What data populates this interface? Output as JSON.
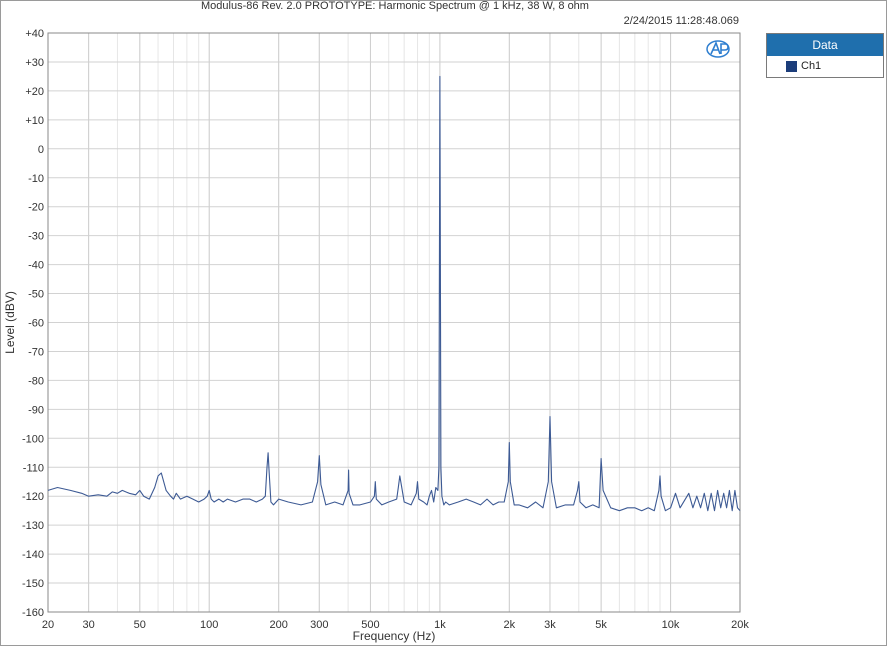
{
  "chart_data": {
    "type": "line",
    "title": "Modulus-86 Rev. 2.0 PROTOTYPE: Harmonic Spectrum @ 1 kHz, 38 W, 8 ohm",
    "timestamp": "2/24/2015 11:28:48.069",
    "xlabel": "Frequency (Hz)",
    "ylabel": "Level (dBV)",
    "x_scale": "log",
    "xlim": [
      20,
      20000
    ],
    "ylim": [
      -160,
      40
    ],
    "x_ticks": [
      {
        "value": 20,
        "label": "20"
      },
      {
        "value": 30,
        "label": "30"
      },
      {
        "value": 50,
        "label": "50"
      },
      {
        "value": 100,
        "label": "100"
      },
      {
        "value": 200,
        "label": "200"
      },
      {
        "value": 300,
        "label": "300"
      },
      {
        "value": 500,
        "label": "500"
      },
      {
        "value": 1000,
        "label": "1k"
      },
      {
        "value": 2000,
        "label": "2k"
      },
      {
        "value": 3000,
        "label": "3k"
      },
      {
        "value": 5000,
        "label": "5k"
      },
      {
        "value": 10000,
        "label": "10k"
      },
      {
        "value": 20000,
        "label": "20k"
      }
    ],
    "y_ticks": [
      {
        "value": 40,
        "label": "+40"
      },
      {
        "value": 30,
        "label": "+30"
      },
      {
        "value": 20,
        "label": "+20"
      },
      {
        "value": 10,
        "label": "+10"
      },
      {
        "value": 0,
        "label": "0"
      },
      {
        "value": -10,
        "label": "-10"
      },
      {
        "value": -20,
        "label": "-20"
      },
      {
        "value": -30,
        "label": "-30"
      },
      {
        "value": -40,
        "label": "-40"
      },
      {
        "value": -50,
        "label": "-50"
      },
      {
        "value": -60,
        "label": "-60"
      },
      {
        "value": -70,
        "label": "-70"
      },
      {
        "value": -80,
        "label": "-80"
      },
      {
        "value": -90,
        "label": "-90"
      },
      {
        "value": -100,
        "label": "-100"
      },
      {
        "value": -110,
        "label": "-110"
      },
      {
        "value": -120,
        "label": "-120"
      },
      {
        "value": -130,
        "label": "-130"
      },
      {
        "value": -140,
        "label": "-140"
      },
      {
        "value": -150,
        "label": "-150"
      },
      {
        "value": -160,
        "label": "-160"
      }
    ],
    "grid": true,
    "legend": {
      "title": "Data",
      "position": "right",
      "entries": [
        {
          "name": "Ch1",
          "color": "#1c3d7a"
        }
      ]
    },
    "series": [
      {
        "name": "Ch1",
        "color": "#3d5a94",
        "x": [
          20,
          22,
          25,
          28,
          30,
          33,
          36,
          38,
          40,
          42,
          45,
          48,
          50,
          52,
          55,
          58,
          60,
          62,
          65,
          68,
          70,
          72,
          75,
          80,
          85,
          90,
          95,
          98,
          100,
          102,
          105,
          110,
          115,
          120,
          130,
          140,
          150,
          160,
          170,
          175,
          178,
          180,
          182,
          185,
          190,
          200,
          220,
          250,
          280,
          295,
          300,
          305,
          320,
          350,
          380,
          400,
          402,
          404,
          420,
          450,
          500,
          520,
          525,
          530,
          560,
          600,
          650,
          660,
          670,
          700,
          750,
          790,
          800,
          810,
          850,
          880,
          900,
          920,
          940,
          960,
          980,
          990,
          1000,
          1010,
          1020,
          1040,
          1060,
          1100,
          1200,
          1300,
          1400,
          1500,
          1600,
          1700,
          1800,
          1900,
          1980,
          2000,
          2020,
          2100,
          2200,
          2400,
          2600,
          2800,
          2950,
          3000,
          3050,
          3200,
          3500,
          3800,
          3950,
          4000,
          4050,
          4300,
          4600,
          4900,
          5000,
          5100,
          5500,
          6000,
          6500,
          7000,
          7500,
          8000,
          8500,
          8900,
          9000,
          9100,
          9500,
          10000,
          10500,
          11000,
          12000,
          12500,
          13000,
          13500,
          14000,
          14500,
          15000,
          15500,
          16000,
          16500,
          17000,
          17500,
          18000,
          18500,
          19000,
          19500,
          20000
        ],
        "y": [
          -118,
          -117,
          -118,
          -119,
          -120,
          -119.5,
          -120,
          -118.5,
          -119,
          -118,
          -119,
          -119.5,
          -118,
          -120,
          -121,
          -117,
          -113,
          -112,
          -118,
          -120,
          -121,
          -119,
          -121,
          -120,
          -121,
          -122,
          -121,
          -120,
          -118,
          -121,
          -122,
          -121,
          -122,
          -121,
          -122,
          -121,
          -121,
          -122,
          -121,
          -120,
          -110,
          -105,
          -112,
          -122,
          -123,
          -121,
          -122,
          -123,
          -122,
          -115,
          -106,
          -116,
          -123,
          -122,
          -123,
          -118,
          -111,
          -119,
          -123,
          -123,
          -122,
          -120,
          -115,
          -121,
          -123,
          -122,
          -121,
          -117,
          -113,
          -122,
          -123,
          -119,
          -115,
          -121,
          -122,
          -123,
          -120,
          -118,
          -122,
          -117,
          -118,
          -110,
          25,
          -110,
          -120,
          -123,
          -122,
          -123,
          -122,
          -121,
          -122,
          -123,
          -121,
          -123,
          -122,
          -122,
          -115,
          -101.5,
          -115,
          -123,
          -123,
          -124,
          -122,
          -124,
          -115,
          -92.5,
          -115,
          -124,
          -123,
          -123,
          -118,
          -115,
          -122,
          -124,
          -123,
          -124,
          -107,
          -118,
          -124,
          -125,
          -124,
          -124,
          -125,
          -124,
          -125,
          -118,
          -113,
          -120,
          -125,
          -124,
          -119,
          -124,
          -119,
          -124,
          -120,
          -124,
          -119,
          -125,
          -119,
          -125,
          -118,
          -124,
          -119,
          -124,
          -118,
          -125,
          -118,
          -124,
          -125
        ]
      }
    ]
  }
}
